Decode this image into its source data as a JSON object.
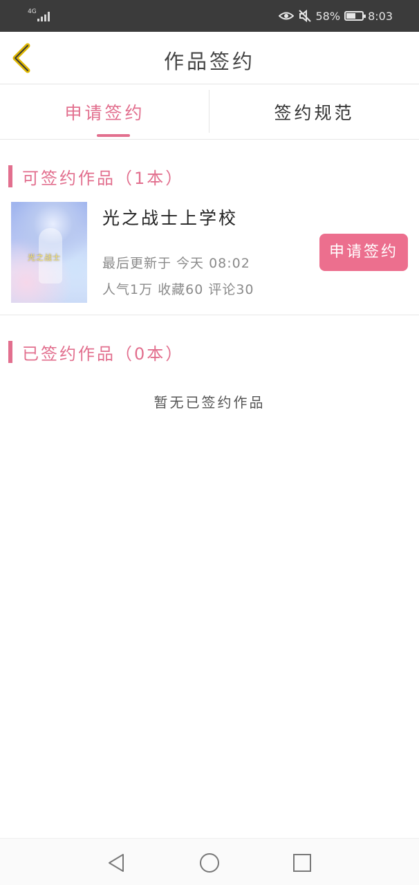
{
  "status_bar": {
    "network": "4G",
    "battery": "58%",
    "battery_level": 0.58,
    "time": "8:03",
    "icons": [
      "eye-icon",
      "mute-icon"
    ]
  },
  "header": {
    "title": "作品签约",
    "back_icon": "chevron-left-icon"
  },
  "tabs": [
    {
      "label": "申请签约",
      "active": true
    },
    {
      "label": "签约规范",
      "active": false
    }
  ],
  "signable": {
    "title": "可签约作品（1本）",
    "books": [
      {
        "title": "光之战士上学校",
        "updated": "最后更新于 今天 08:02",
        "stats": "人气1万 收藏60 评论30",
        "apply_label": "申请签约",
        "cover_text": "光之战士"
      }
    ]
  },
  "signed": {
    "title": "已签约作品（0本）",
    "empty_text": "暂无已签约作品"
  },
  "nav": {
    "icons": [
      "nav-back-icon",
      "nav-home-icon",
      "nav-recent-icon"
    ]
  },
  "colors": {
    "accent": "#e26f8e",
    "button": "#ec6f8e",
    "status_bar": "#3b3b3b"
  }
}
